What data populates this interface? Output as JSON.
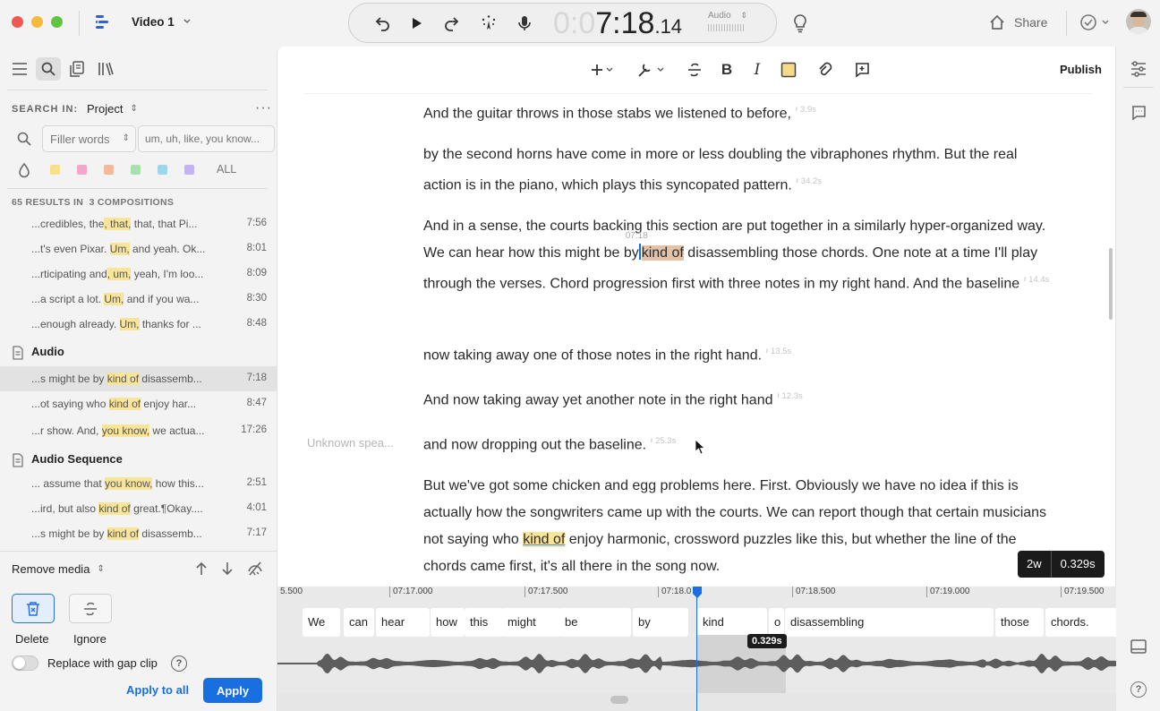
{
  "app": {
    "title": "Video 1"
  },
  "transport": {
    "timecode_dim": "0:0",
    "timecode_main": "7:18",
    "timecode_ms": ".14",
    "audio_label": "Audio"
  },
  "header": {
    "share_label": "Share"
  },
  "sidebar": {
    "search_in_label": "SEARCH IN:",
    "search_scope": "Project",
    "filter_dropdown": "Filler words",
    "filter_placeholder": "um, uh, like, you know...",
    "all_label": "ALL",
    "results_summary": "65 RESULTS IN  3 COMPOSITIONS",
    "groups": [
      {
        "title": "",
        "results": [
          {
            "pre": "...credibles, the",
            "hit": ", that,",
            "post": " that, that Pi...",
            "time": "7:56"
          },
          {
            "pre": "...t's even Pixar. ",
            "hit": "Um,",
            "post": " and yeah. Ok...",
            "time": "8:01"
          },
          {
            "pre": "...rticipating and",
            "hit": ", um,",
            "post": " yeah, I'm loo...",
            "time": "8:09"
          },
          {
            "pre": "...a script a lot. ",
            "hit": "Um,",
            "post": " and if you wa...",
            "time": "8:30"
          },
          {
            "pre": "...enough already. ",
            "hit": "Um,",
            "post": " thanks for ...",
            "time": "8:48"
          }
        ]
      },
      {
        "title": "Audio",
        "results": [
          {
            "pre": "...s might be by ",
            "hit": "kind of",
            "post": " disassemb...",
            "time": "7:18"
          },
          {
            "pre": "...ot saying who ",
            "hit": "kind of",
            "post": " enjoy har...",
            "time": "8:47"
          },
          {
            "pre": "...r show. And, ",
            "hit": "you know,",
            "post": " we actua...",
            "time": "17:26"
          }
        ]
      },
      {
        "title": "Audio Sequence",
        "results": [
          {
            "pre": "... assume that ",
            "hit": "you know,",
            "post": " how this...",
            "time": "2:51"
          },
          {
            "pre": "...ird, but also ",
            "hit": "kind of",
            "post": " great.¶Okay....",
            "time": "4:01"
          },
          {
            "pre": "...s might be by ",
            "hit": "kind of",
            "post": " disassemb...",
            "time": "7:17"
          }
        ]
      }
    ],
    "action_dropdown": "Remove media",
    "delete_label": "Delete",
    "ignore_label": "Ignore",
    "gap_clip_label": "Replace with gap clip",
    "apply_all_label": "Apply to all",
    "apply_label": "Apply"
  },
  "toolbar": {
    "publish_label": "Publish"
  },
  "editor": {
    "speaker_label": "Unknown spea...",
    "playhead_time": "07:18",
    "paragraphs": [
      {
        "text": "And the guitar throws in those stabs we listened to before,",
        "gap": "3.9s"
      },
      {
        "text": "by the second horns have come in more or less doubling the vibraphones rhythm. But the real action is in the piano, which plays this syncopated pattern.",
        "gap": "34.2s"
      },
      {
        "pre": "And in a sense, the courts backing this section are put together in a similarly hyper-organized way. We can hear how this might be by",
        "hit": "kind of",
        "post": " disassembling those chords. One note at a time I'll play through the verses. Chord progression first with three notes in my right hand. And the baseline",
        "gap": "14.4s"
      },
      {
        "text": "now taking away one of those notes in the right hand.",
        "gap": "13.5s"
      },
      {
        "text": "And now taking away yet another note in the right hand",
        "gap": "12.3s"
      },
      {
        "text": "and now dropping out the baseline.",
        "gap": "25.3s"
      },
      {
        "pre": "But we've got some chicken and egg problems here. First. Obviously we have no idea if this is actually how the songwriters came up with the courts. We can report though that certain musicians not saying who ",
        "hit": "kind of",
        "post": " enjoy harmonic, crossword puzzles like this, but whether the line of the chords came first, it's all there in the song now."
      }
    ],
    "selection_words": "2w",
    "selection_duration": "0.329s"
  },
  "timeline": {
    "ticks": [
      "5.500",
      "07:17.000",
      "07:17.500",
      "07:18.0",
      "07:18.500",
      "07:19.000",
      "07:19.500"
    ],
    "words": [
      "We",
      "can",
      "hear",
      "how",
      "this",
      "might",
      "be",
      "by",
      "kind",
      "o",
      "disassembling",
      "those",
      "chords."
    ],
    "selection_badge": "0.329s"
  },
  "colors": {
    "accent": "#1a6fe0",
    "highlight": "#f9e59a",
    "selection": "#e3c3a8",
    "swatches": [
      "#f7e08a",
      "#f4a6c8",
      "#f4b99a",
      "#a8e0b0",
      "#9ed6ee",
      "#c3b3f0"
    ]
  }
}
